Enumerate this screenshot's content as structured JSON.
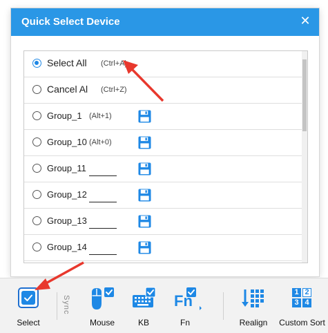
{
  "dialog": {
    "title": "Quick Select Device",
    "close_symbol": "✕"
  },
  "list": {
    "rows": [
      {
        "label": "Select All",
        "shortcut": "(Ctrl+A)",
        "checked": true
      },
      {
        "label": "Cancel Al",
        "shortcut": "(Ctrl+Z)",
        "checked": false
      },
      {
        "label": "Group_1",
        "shortcut": "(Alt+1)"
      },
      {
        "label": "Group_10",
        "shortcut": "(Alt+0)"
      },
      {
        "label": "Group_11",
        "shortcut": ""
      },
      {
        "label": "Group_12",
        "shortcut": ""
      },
      {
        "label": "Group_13",
        "shortcut": ""
      },
      {
        "label": "Group_14",
        "shortcut": ""
      }
    ]
  },
  "toolbar": {
    "select_label": "Select",
    "sync_label": "Sync",
    "mouse_label": "Mouse",
    "kb_label": "KB",
    "fn_label": "Fn",
    "fn_text": "Fn",
    "realign_label": "Realign",
    "custom_sort_label": "Custom Sort",
    "sort_digits": [
      "1",
      "2",
      "3",
      "4"
    ]
  },
  "colors": {
    "header": "#2a97e6",
    "accent": "#1e88e5",
    "arrow": "#e8382d"
  },
  "icons": {
    "save": "floppy-disk-icon",
    "mouse": "mouse-icon",
    "keyboard": "keyboard-icon",
    "close": "close-icon"
  }
}
